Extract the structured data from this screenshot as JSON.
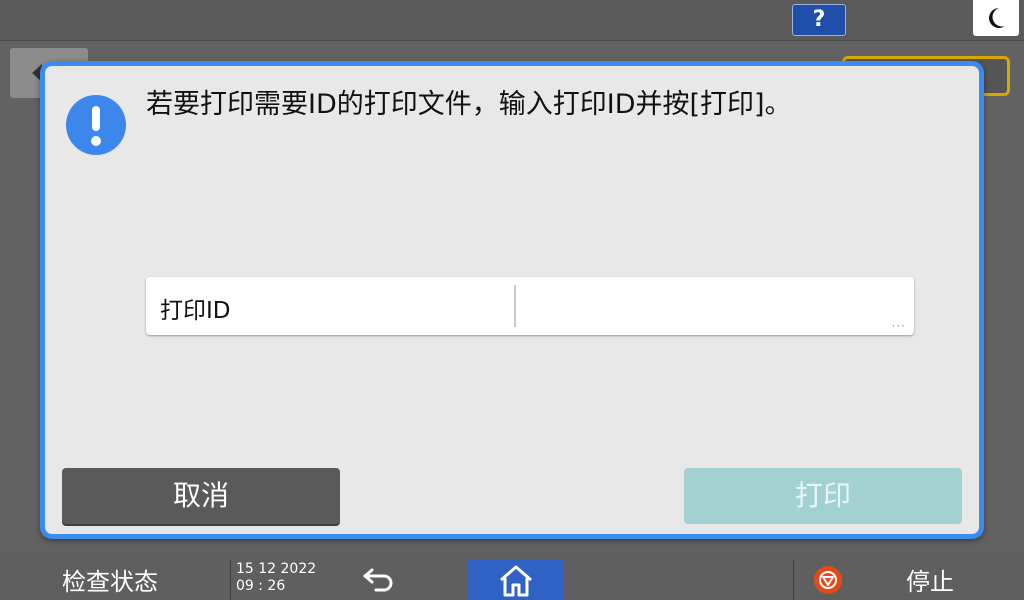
{
  "topbar": {
    "help_label": "?",
    "night_icon": "moon-icon"
  },
  "background_screen": {
    "back_icon": "back-arrow-icon"
  },
  "dialog": {
    "icon": "exclamation-icon",
    "message": "若要打印需要ID的打印文件，输入打印ID并按[打印]。",
    "id_field": {
      "label": "打印ID",
      "value": "",
      "more_indicator": "···"
    },
    "cancel_label": "取消",
    "print_label": "打印"
  },
  "bottombar": {
    "status_label": "检查状态",
    "date": "15 12 2022",
    "time": "09 : 26",
    "back_icon": "undo-arrow-icon",
    "home_icon": "home-icon",
    "stop_icon": "stop-icon",
    "stop_label": "停止"
  },
  "colors": {
    "accent_blue": "#3c8cf0",
    "print_button_disabled": "#a3d1d1",
    "stop_orange": "#e44a1a"
  }
}
